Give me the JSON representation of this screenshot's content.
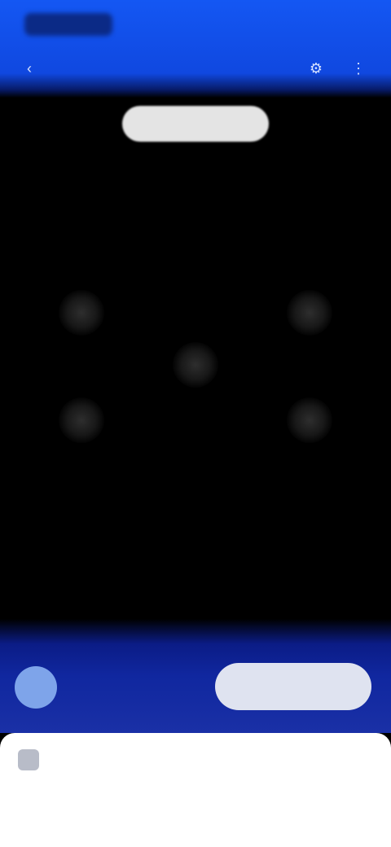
{
  "status_bar": {
    "time": "",
    "indicators": ""
  },
  "header": {
    "title": "",
    "back_icon": "arrow-left-icon",
    "settings_icon": "gear-icon",
    "more_icon": "more-icon"
  },
  "viewport": {
    "hint": ""
  },
  "device": {
    "name": "",
    "status": "",
    "action_label": ""
  },
  "card": {
    "title": "",
    "subtitle": ""
  },
  "colors": {
    "header_blue": "#1457f3",
    "panel_blue": "#10279f",
    "avatar": "#7ea4ea"
  }
}
